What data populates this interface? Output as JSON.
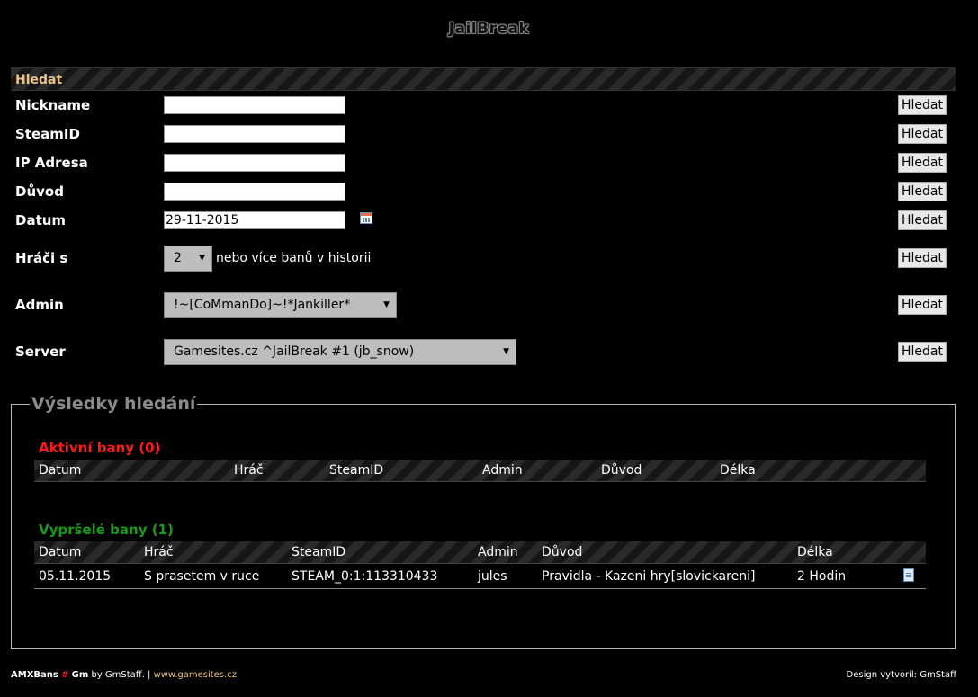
{
  "site": {
    "title": "JailBreak"
  },
  "search": {
    "header": "Hledat",
    "button_label": "Hledat",
    "fields": {
      "nickname": {
        "label": "Nickname",
        "value": ""
      },
      "steamid": {
        "label": "SteamID",
        "value": ""
      },
      "ip": {
        "label": "IP Adresa",
        "value": ""
      },
      "reason": {
        "label": "Důvod",
        "value": ""
      },
      "date": {
        "label": "Datum",
        "value": "29-11-2015",
        "icon": "calendar-icon"
      }
    },
    "players": {
      "label": "Hráči s",
      "count": "2",
      "suffix": "nebo více banů v historii"
    },
    "admin": {
      "label": "Admin",
      "selected": "!~[CoMmanDo]~!*Jankiller*"
    },
    "server": {
      "label": "Server",
      "selected": "Gamesites.cz ^JailBreak #1 (jb_snow)"
    }
  },
  "results": {
    "legend": "Výsledky hledání",
    "active": {
      "title": "Aktivní bany (0)",
      "columns": [
        "Datum",
        "Hráč",
        "SteamID",
        "Admin",
        "Důvod",
        "Délka"
      ],
      "rows": []
    },
    "expired": {
      "title": "Vypršelé bany (1)",
      "columns": [
        "Datum",
        "Hráč",
        "SteamID",
        "Admin",
        "Důvod",
        "Délka"
      ],
      "rows": [
        {
          "date": "05.11.2015",
          "player": "S prasetem v ruce",
          "steamid": "STEAM_0:1:113310433",
          "admin": "jules",
          "reason": "Pravidla - Kazeni hry[slovickareni]",
          "length": "2 Hodin",
          "icon": "document-icon"
        }
      ]
    }
  },
  "footer": {
    "brand": "AMXBans",
    "hash": "#",
    "gm": "Gm",
    "by": "by GmStaff. |",
    "link": "www.gamesites.cz",
    "design": "Design vytvoril: GmStaff"
  },
  "colors": {
    "accent": "#e9c38a",
    "active": "#ff1a1a",
    "expired": "#1a9c1a",
    "background": "#000000"
  }
}
